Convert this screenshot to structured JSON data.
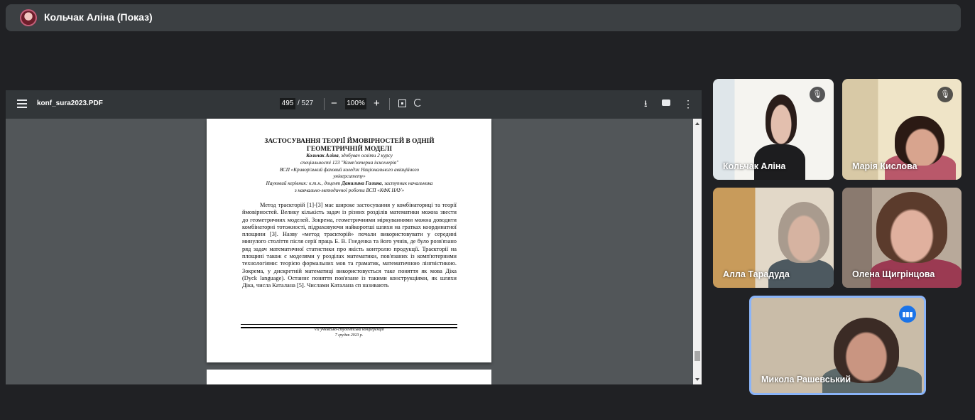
{
  "header": {
    "title": "Кольчак Аліна (Показ)"
  },
  "pdf_viewer": {
    "file_name": "konf_sura2023.PDF",
    "current_page": "495",
    "total_pages": "/ 527",
    "zoom": "100%",
    "zoom_out": "−",
    "zoom_in": "+"
  },
  "document": {
    "title_line1": "ЗАСТОСУВАННЯ ТЕОРІЇ ЙМОВІРНОСТЕЙ В ОДНІЙ",
    "title_line2": "ГЕОМЕТРИЧНІЙ МОДЕЛІ",
    "author_name": "Кольчак Аліна",
    "author_desc": ", здобувач освіти 2 курсу",
    "specialty": "спеціальності 123 \"Комп'ютерна інженерія\"",
    "institution1": "ВСП «Криворізький фаховий коледж Національного авіаційного",
    "institution2": "університету»",
    "supervisor_prefix": "Науковий керівник: к.т.н., доцент ",
    "supervisor_name": "Данилина Галина",
    "supervisor_suffix": ", заступник начальника",
    "supervisor_line2": "з навчально-методичної роботи ВСП «КФК НАУ»",
    "body": "Метод траєкторій [1]-[3] має широке застосування у комбінаториці та теорії ймовірностей. Велику кількість задач із різних розділів математики можна звести до геометричних моделей. Зокрема, геометричними міркуваннями можна доводити комбінаторні тотожності, підраховуючи найкоротші шляхи на гратках координатної площини [3]. Назву «метод траєкторій» почали використовувати у середині минулого століття після серії праць Б. В. Гнеденка та його учнів, де було розв'язано ряд задач математичної статистики про якість контролю продукції. Траєкторії на площині також є моделями у розділах математики, пов'язаних із комп'ютерними технологіями: теорією формальних мов та граматик, математичною лінгвістикою. Зокрема, у дискретній математиці використовується таке поняття як мова Діка (Dyck language). Останнє поняття пов'язане із такими конструкціями, як шляхи Діка, числа Каталана [5]. Числами Каталана сп називають",
    "footer_line1": "VII учнівсько-студентська конференція",
    "footer_line2": "7 грудня 2023 р."
  },
  "participants": [
    {
      "name": "Кольчак Аліна",
      "muted": true
    },
    {
      "name": "Марія Кислова",
      "muted": true
    },
    {
      "name": "Алла Тарадуда",
      "muted": false
    },
    {
      "name": "Олена Щигрінцова",
      "muted": false
    },
    {
      "name": "Микола Рашевський",
      "speaking": true
    }
  ],
  "icons": {
    "menu": "menu-icon",
    "download": "download-icon",
    "print": "print-icon",
    "more": "more-vert-icon",
    "mic_off": "mic-off-icon",
    "speaking": "speaking-icon",
    "fit": "fit-page-icon",
    "rotate": "rotate-icon"
  },
  "colors": {
    "accent": "#1a73e8",
    "background": "#202124",
    "toolbar": "#323639"
  }
}
